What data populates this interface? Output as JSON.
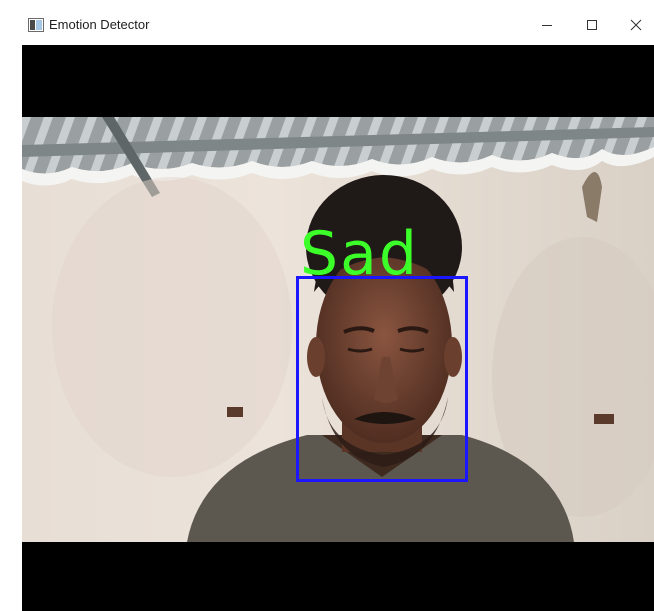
{
  "window": {
    "title": "Emotion Detector",
    "icon": "app-window-icon",
    "controls": [
      "minimize-icon",
      "maximize-icon",
      "close-icon"
    ]
  },
  "video": {
    "detection": {
      "label": "Sad",
      "label_color": "#3cff2a",
      "box_color": "#1b16ff"
    }
  },
  "colors": {
    "frame_background": "#000000",
    "titlebar_background": "#ffffff"
  }
}
